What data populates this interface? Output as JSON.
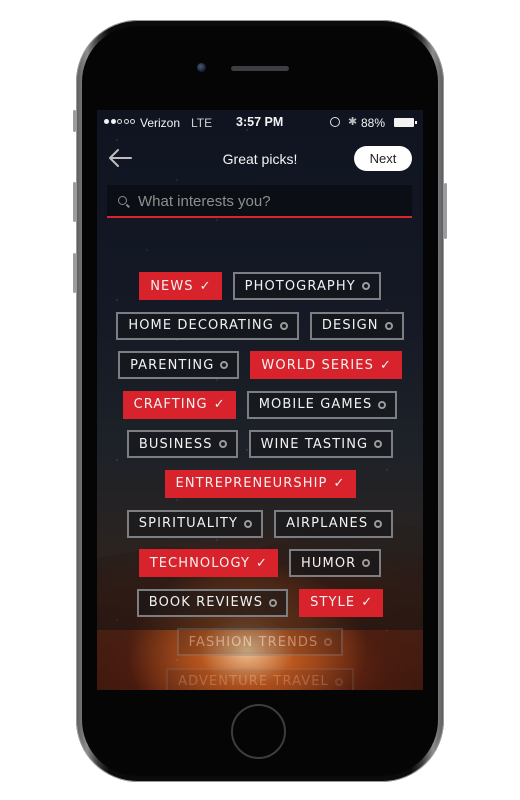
{
  "status_bar": {
    "signal_bars_filled": 2,
    "signal_bars_total": 5,
    "carrier": "Verizon",
    "network": "LTE",
    "time": "3:57 PM",
    "battery_percent": "88%",
    "icons": [
      "rotation-lock-icon",
      "bluetooth-icon",
      "battery-icon"
    ]
  },
  "nav": {
    "back_icon": "arrow-left-icon",
    "title": "Great picks!",
    "next_label": "Next"
  },
  "search": {
    "placeholder": "What interests you?",
    "value": "",
    "icon": "search-icon"
  },
  "colors": {
    "accent": "#d8232d",
    "chip_border": "#7c7e82",
    "text": "#f2f2f2"
  },
  "interests": {
    "rows": [
      [
        {
          "label": "NEWS",
          "selected": true
        },
        {
          "label": "PHOTOGRAPHY",
          "selected": false
        }
      ],
      [
        {
          "label": "HOME DECORATING",
          "selected": false
        },
        {
          "label": "DESIGN",
          "selected": false
        }
      ],
      [
        {
          "label": "PARENTING",
          "selected": false
        },
        {
          "label": "WORLD SERIES",
          "selected": true
        }
      ],
      [
        {
          "label": "CRAFTING",
          "selected": true
        },
        {
          "label": "MOBILE GAMES",
          "selected": false
        }
      ],
      [
        {
          "label": "BUSINESS",
          "selected": false
        },
        {
          "label": "WINE TASTING",
          "selected": false
        }
      ],
      [
        {
          "label": "ENTREPRENEURSHIP",
          "selected": true
        }
      ],
      [
        {
          "label": "SPIRITUALITY",
          "selected": false
        },
        {
          "label": "AIRPLANES",
          "selected": false
        }
      ],
      [
        {
          "label": "TECHNOLOGY",
          "selected": true
        },
        {
          "label": "HUMOR",
          "selected": false
        }
      ],
      [
        {
          "label": "BOOK REVIEWS",
          "selected": false
        },
        {
          "label": "STYLE",
          "selected": true
        }
      ],
      [
        {
          "label": "FASHION TRENDS",
          "selected": false,
          "faded": true
        }
      ],
      [
        {
          "label": "ADVENTURE TRAVEL",
          "selected": false,
          "faded": true
        }
      ]
    ],
    "selected_icon": "✓",
    "unselected_icon": "circle-icon"
  }
}
